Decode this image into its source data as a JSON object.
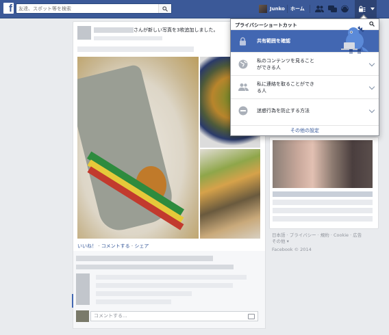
{
  "topbar": {
    "logo": "f",
    "search_placeholder": "友達、スポット等を検索",
    "user_name": "Junko",
    "home_label": "ホーム",
    "icons": [
      "friend-requests-icon",
      "messages-icon",
      "notifications-icon",
      "privacy-shortcuts-icon",
      "account-caret-icon"
    ]
  },
  "post": {
    "header_suffix": "さんが新しい写真を3枚追加しました。",
    "like": "いいね！",
    "comment": "コメントする",
    "share": "シェア",
    "comment_placeholder": "コメントする..."
  },
  "privacy_menu": {
    "title": "プライバシーショートカット",
    "items": [
      {
        "label": "共有範囲を確認",
        "icon": "lock-icon"
      },
      {
        "label_line1": "私のコンテンツを見ること",
        "label_line2": "ができる人",
        "icon": "globe-icon"
      },
      {
        "label_line1": "私に連絡を取ることができ",
        "label_line2": "る人",
        "icon": "people-icon"
      },
      {
        "label": "迷惑行為を防止する方法",
        "icon": "block-icon"
      }
    ],
    "footer": "その他の設定"
  },
  "footer": {
    "links": "日本語 · プライバシー · 規約 · Cookie · 広告",
    "more": "その他 ▾",
    "copyright": "Facebook © 2014"
  },
  "colors": {
    "brand": "#3b5998",
    "active_item": "#4267b2",
    "link": "#365899"
  }
}
